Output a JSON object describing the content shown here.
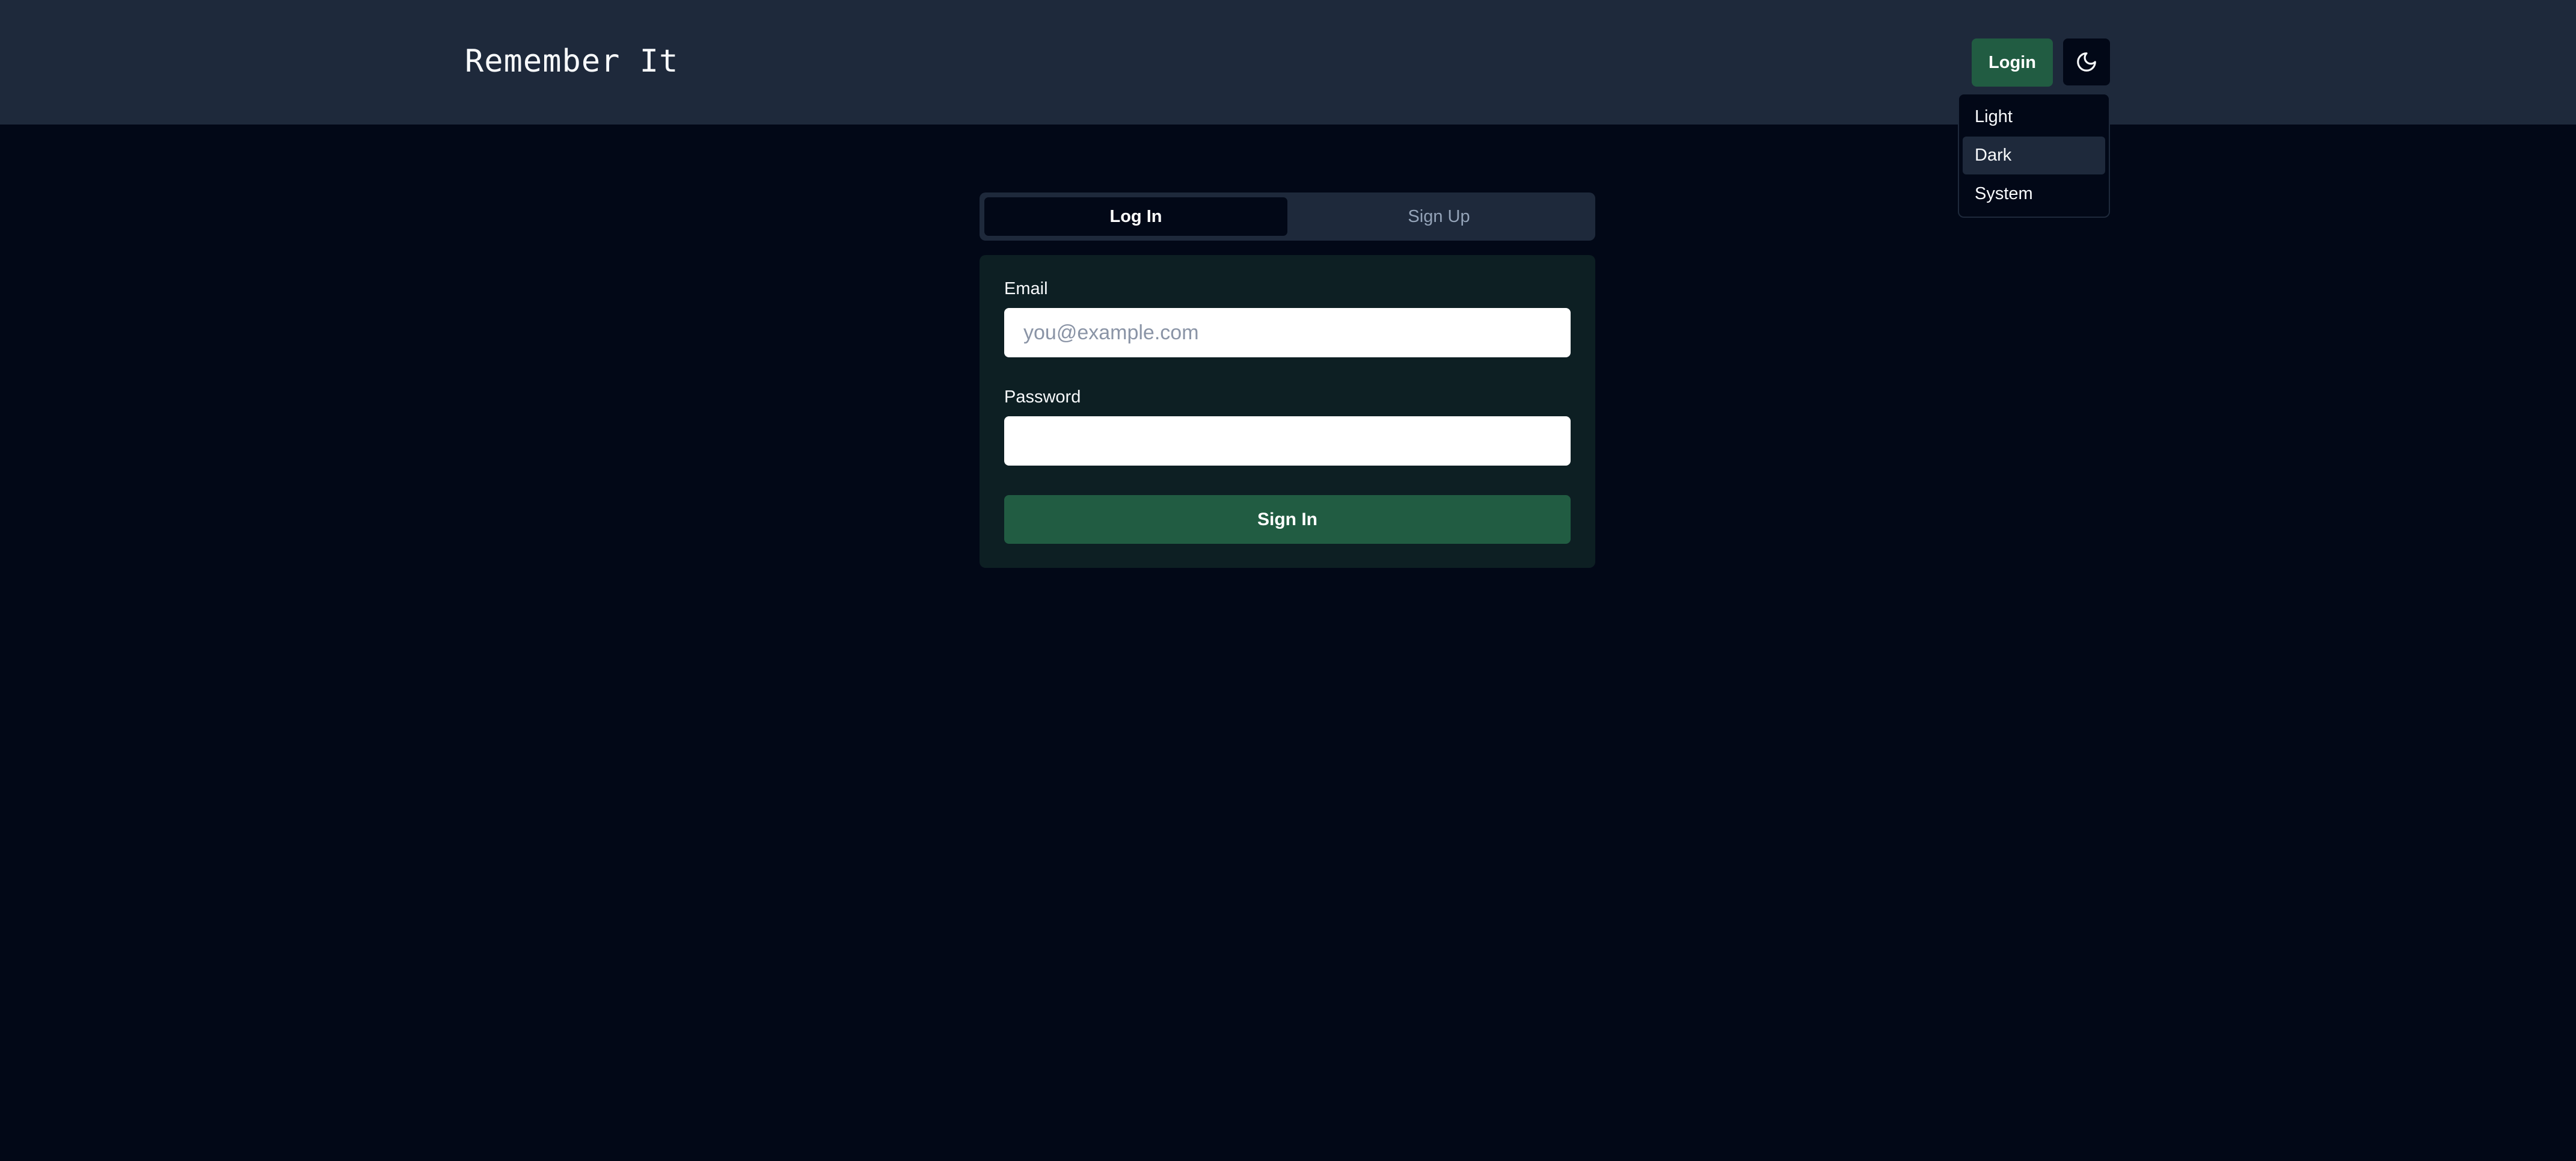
{
  "header": {
    "title": "Remember It",
    "login_label": "Login",
    "theme_icon": "moon-icon"
  },
  "theme_menu": {
    "items": [
      {
        "label": "Light"
      },
      {
        "label": "Dark"
      },
      {
        "label": "System"
      }
    ],
    "selected": "Dark"
  },
  "auth": {
    "tabs": [
      {
        "label": "Log In"
      },
      {
        "label": "Sign Up"
      }
    ],
    "active_tab": "Log In",
    "email_label": "Email",
    "email_placeholder": "you@example.com",
    "email_value": "",
    "password_label": "Password",
    "password_value": "",
    "submit_label": "Sign In"
  },
  "colors": {
    "background": "#020817",
    "header": "#1e293b",
    "accent": "#215c42",
    "card": "#0d1f23"
  }
}
